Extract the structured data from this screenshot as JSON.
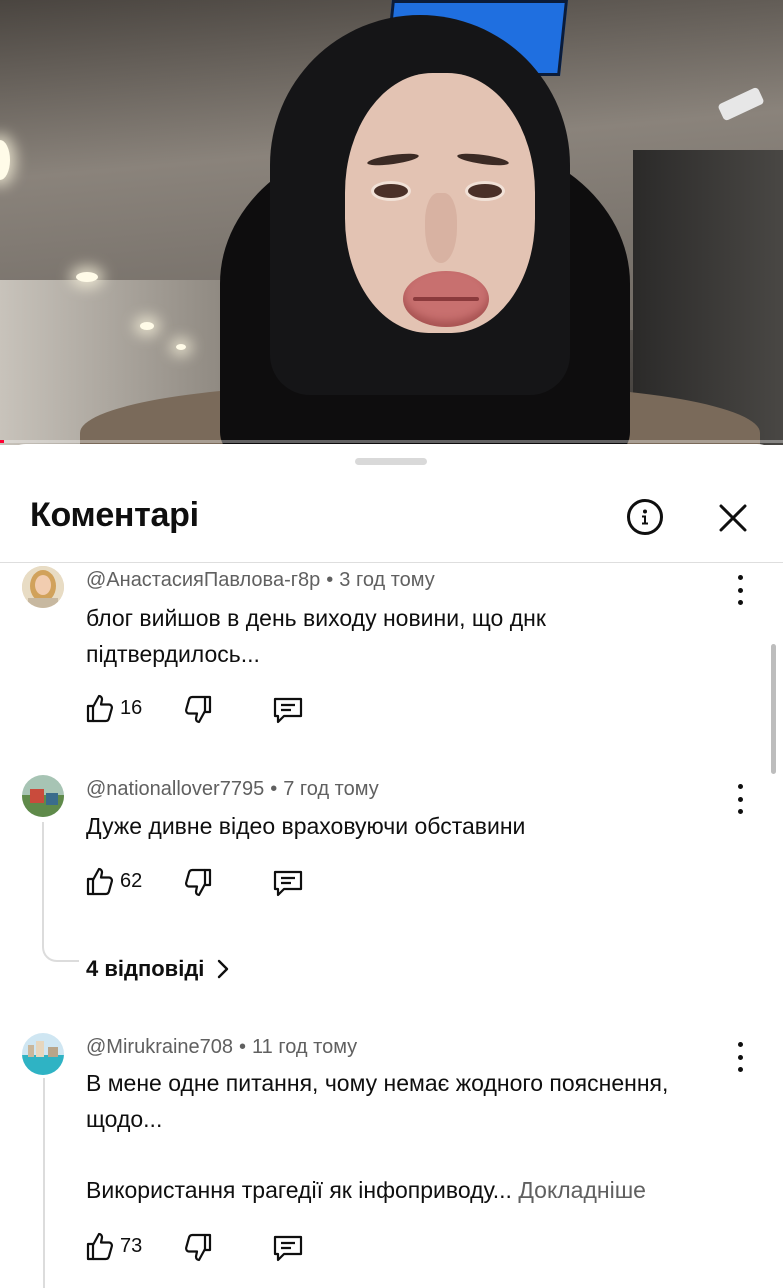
{
  "video": {
    "progress_fraction": 0.005
  },
  "sheet": {
    "title": "Коментарі",
    "info_icon": "info-icon",
    "close_icon": "close-icon"
  },
  "comments": [
    {
      "author": "@АнастасияПавлова-г8р",
      "time": "3 год тому",
      "text": "блог вийшов в день виходу новини, що днк підтвердилось...",
      "likes": "16"
    },
    {
      "author": "@nationallover7795",
      "time": "7 год тому",
      "text": "Дуже дивне відео враховуючи обставини",
      "likes": "62",
      "replies_label": "4 відповіді"
    },
    {
      "author": "@Mirukraine708",
      "time": "11 год тому",
      "text_line1": "В мене одне питання, чому немає жодного пояснення, щодо...",
      "text_line2": "Використання трагедії як інфоприводу...",
      "more_label": "Докладніше",
      "likes": "73"
    }
  ],
  "colors": {
    "accent": "#ff0033",
    "text": "#0f0f0f",
    "secondary": "#606060"
  }
}
